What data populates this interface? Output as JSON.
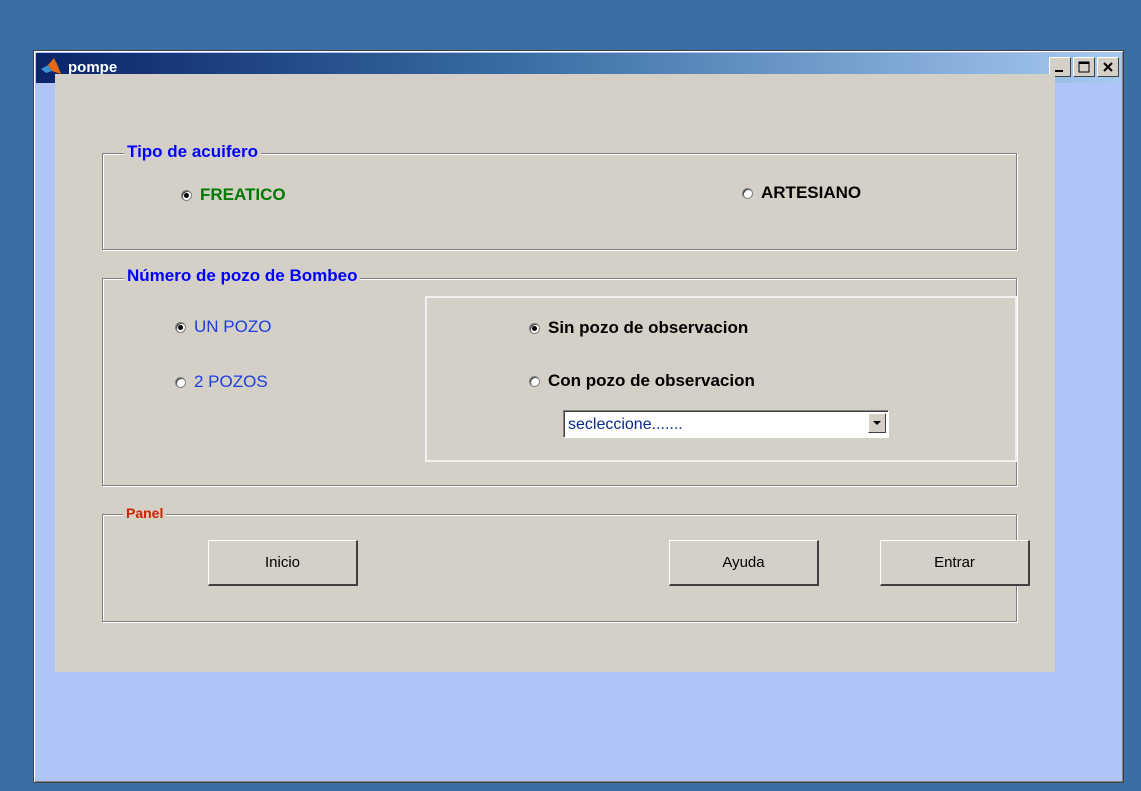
{
  "window": {
    "title": "pompe",
    "app_icon": "matlab-icon"
  },
  "window_controls": [
    "minimize-icon",
    "maximize-icon",
    "close-icon"
  ],
  "aquifer_group": {
    "legend": "Tipo de acuifero",
    "options": [
      {
        "label": "FREATICO",
        "selected": true
      },
      {
        "label": "ARTESIANO",
        "selected": false
      }
    ]
  },
  "wells_group": {
    "legend": "Número de pozo de Bombeo",
    "well_options": [
      {
        "label": "UN POZO",
        "selected": true
      },
      {
        "label": "2 POZOS",
        "selected": false
      }
    ],
    "observation_options": [
      {
        "label": "Sin pozo de observacion",
        "selected": true
      },
      {
        "label": "Con pozo de observacion",
        "selected": false
      }
    ],
    "select": {
      "value": "secleccione......."
    }
  },
  "panel_group": {
    "legend": "Panel",
    "buttons": {
      "inicio": "Inicio",
      "ayuda": "Ayuda",
      "entrar": "Entrar"
    }
  },
  "colors": {
    "legend_blue": "#0000ff",
    "legend_red": "#cc2200",
    "freatico_green": "#007a00",
    "well_option_blue": "#1c3ee0"
  }
}
